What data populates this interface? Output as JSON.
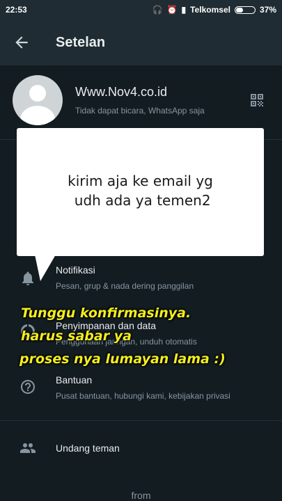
{
  "status_bar": {
    "time": "22:53",
    "carrier": "Telkomsel",
    "battery": "37%",
    "battery_level": 0.37
  },
  "header": {
    "title": "Setelan",
    "back_icon": "arrow-left-icon"
  },
  "profile": {
    "name": "Www.Nov4.co.id",
    "status": "Tidak dapat bicara, WhatsApp saja",
    "qr_icon": "qr-code-icon"
  },
  "settings": {
    "items": [
      {
        "icon": "bell-icon",
        "title": "Notifikasi",
        "subtitle": "Pesan, grup & nada dering panggilan"
      },
      {
        "icon": "data-usage-icon",
        "title": "Penyimpanan dan data",
        "subtitle": "Penggunaan jaringan, unduh otomatis"
      },
      {
        "icon": "help-icon",
        "title": "Bantuan",
        "subtitle": "Pusat bantuan, hubungi kami, kebijakan privasi"
      },
      {
        "icon": "people-icon",
        "title": "Undang teman",
        "subtitle": ""
      }
    ]
  },
  "footer": {
    "from": "from"
  },
  "overlay": {
    "bubble_line1": "kirim aja ke email yg",
    "bubble_line2": " udh ada ya temen2",
    "caption_line1": "Tunggu konfirmasinya.",
    "caption_line2": "harus sabar  ya",
    "caption_line3": "proses nya lumayan lama :)"
  },
  "colors": {
    "background": "#131c21",
    "appbar": "#1f2c33",
    "caption": "#f3ee1e"
  }
}
